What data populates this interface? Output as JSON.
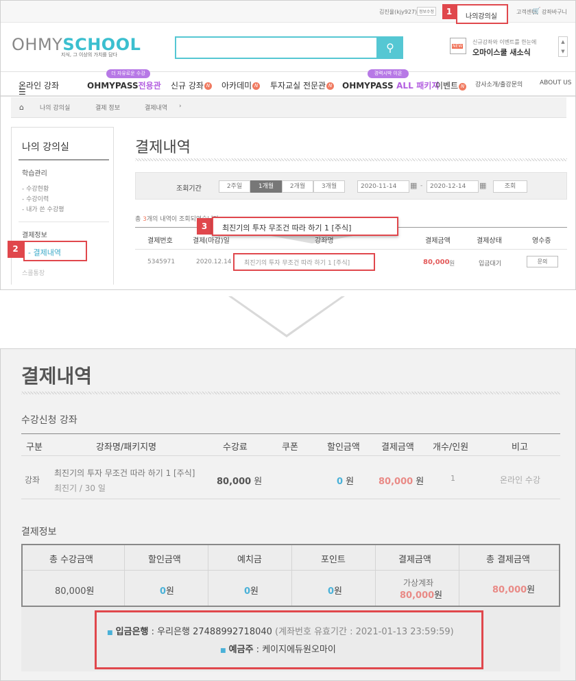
{
  "top": {
    "user": "김진율(kjy927)님",
    "info_edit": "정보수정",
    "my_classroom": "나의강의실",
    "cs_center": "고객센터",
    "cart": "강좌바구니"
  },
  "logo": {
    "part1": "OHMY",
    "part2": "SCHOOL",
    "tagline": "지식, 그 이상의 가치를 담다"
  },
  "promo": {
    "small": "신규강좌와 이벤트를 한눈에",
    "big": "오마이스쿨 새소식",
    "new_badge": "NEW"
  },
  "nav": {
    "all": "온라인 강좌",
    "ohmypass_tag": "더 자유로운 수강",
    "ohmypass": "OHMYPASS",
    "ohmypass_suffix": "전용관",
    "new_course": "신규 강좌",
    "academy": "아카데미",
    "invest": "투자교실 전문관",
    "all_tag": "경력시박 이온",
    "ohmypass_all": "OHMYPASS",
    "all_word": "ALL",
    "package": "패키지",
    "event": "이벤트",
    "lecturer": "강사소개/출강문의",
    "about": "ABOUT US",
    "n": "N"
  },
  "breadcrumb": [
    "나의 강의실",
    "결제 정보",
    "결제내역"
  ],
  "sidebar": {
    "title": "나의 강의실",
    "section1": "학습관리",
    "items1": [
      "- 수강현황",
      "- 수강이력",
      "- 내가 쓴 수강평"
    ],
    "section2": "결제정보",
    "active": "- 결제내역",
    "next": "스콜통장"
  },
  "page_title": "결제내역",
  "filter": {
    "label": "조회기간",
    "chips": [
      "2주일",
      "1개월",
      "2개월",
      "3개월"
    ],
    "from": "2020-11-14",
    "to": "2020-12-14",
    "search": "조회",
    "sep": "-"
  },
  "summary": {
    "prefix": "총 ",
    "count": "3",
    "suffix": "개의 내역이 조회되었습니다."
  },
  "list": {
    "headers": [
      "결제번호",
      "결제(마감)일",
      "강좌명",
      "결제금액",
      "결제상태",
      "영수증"
    ],
    "row": {
      "no": "5345971",
      "date": "2020.12.14",
      "name": "최진기의 투자 무조건 따라 하기 1 [주식]",
      "amount": "80,000",
      "won": "원",
      "status": "입금대기",
      "receipt": "문의"
    }
  },
  "callouts": {
    "n1": "1",
    "n2": "2",
    "n3": "3",
    "tooltip": "최진기의 투자 무조건 따라 하기 1 [주식]"
  },
  "detail": {
    "title": "결제내역",
    "section1": "수강신청 강좌",
    "headers": [
      "구분",
      "강좌명/패키지명",
      "수강료",
      "쿠폰",
      "할인금액",
      "결제금액",
      "개수/인원",
      "비고"
    ],
    "row": {
      "type": "강좌",
      "name": "최진기의 투자 무조건 따라 하기 1 [주식]",
      "sub": "최진기 / 30 일",
      "fee": "80,000",
      "discount": "0",
      "pay": "80,000",
      "count": "1",
      "note": "온라인 수강",
      "won": " 원"
    },
    "section2": "결제정보",
    "pay_headers": [
      "총 수강금액",
      "할인금액",
      "예치금",
      "포인트",
      "결제금액",
      "총 결제금액"
    ],
    "pay_values": {
      "total_fee": "80,000",
      "discount": "0",
      "deposit": "0",
      "point": "0",
      "method": "가상계좌",
      "pay": "80,000",
      "total_pay": "80,000",
      "won": "원"
    },
    "bank": {
      "label1": "입금은행",
      "value1": " : 우리은행 27488992718040",
      "note1": " (계좌번호 유효기간 : 2021-01-13 23:59:59)",
      "label2": "예금주",
      "value2": " : 케이지에듀원오마이"
    }
  }
}
